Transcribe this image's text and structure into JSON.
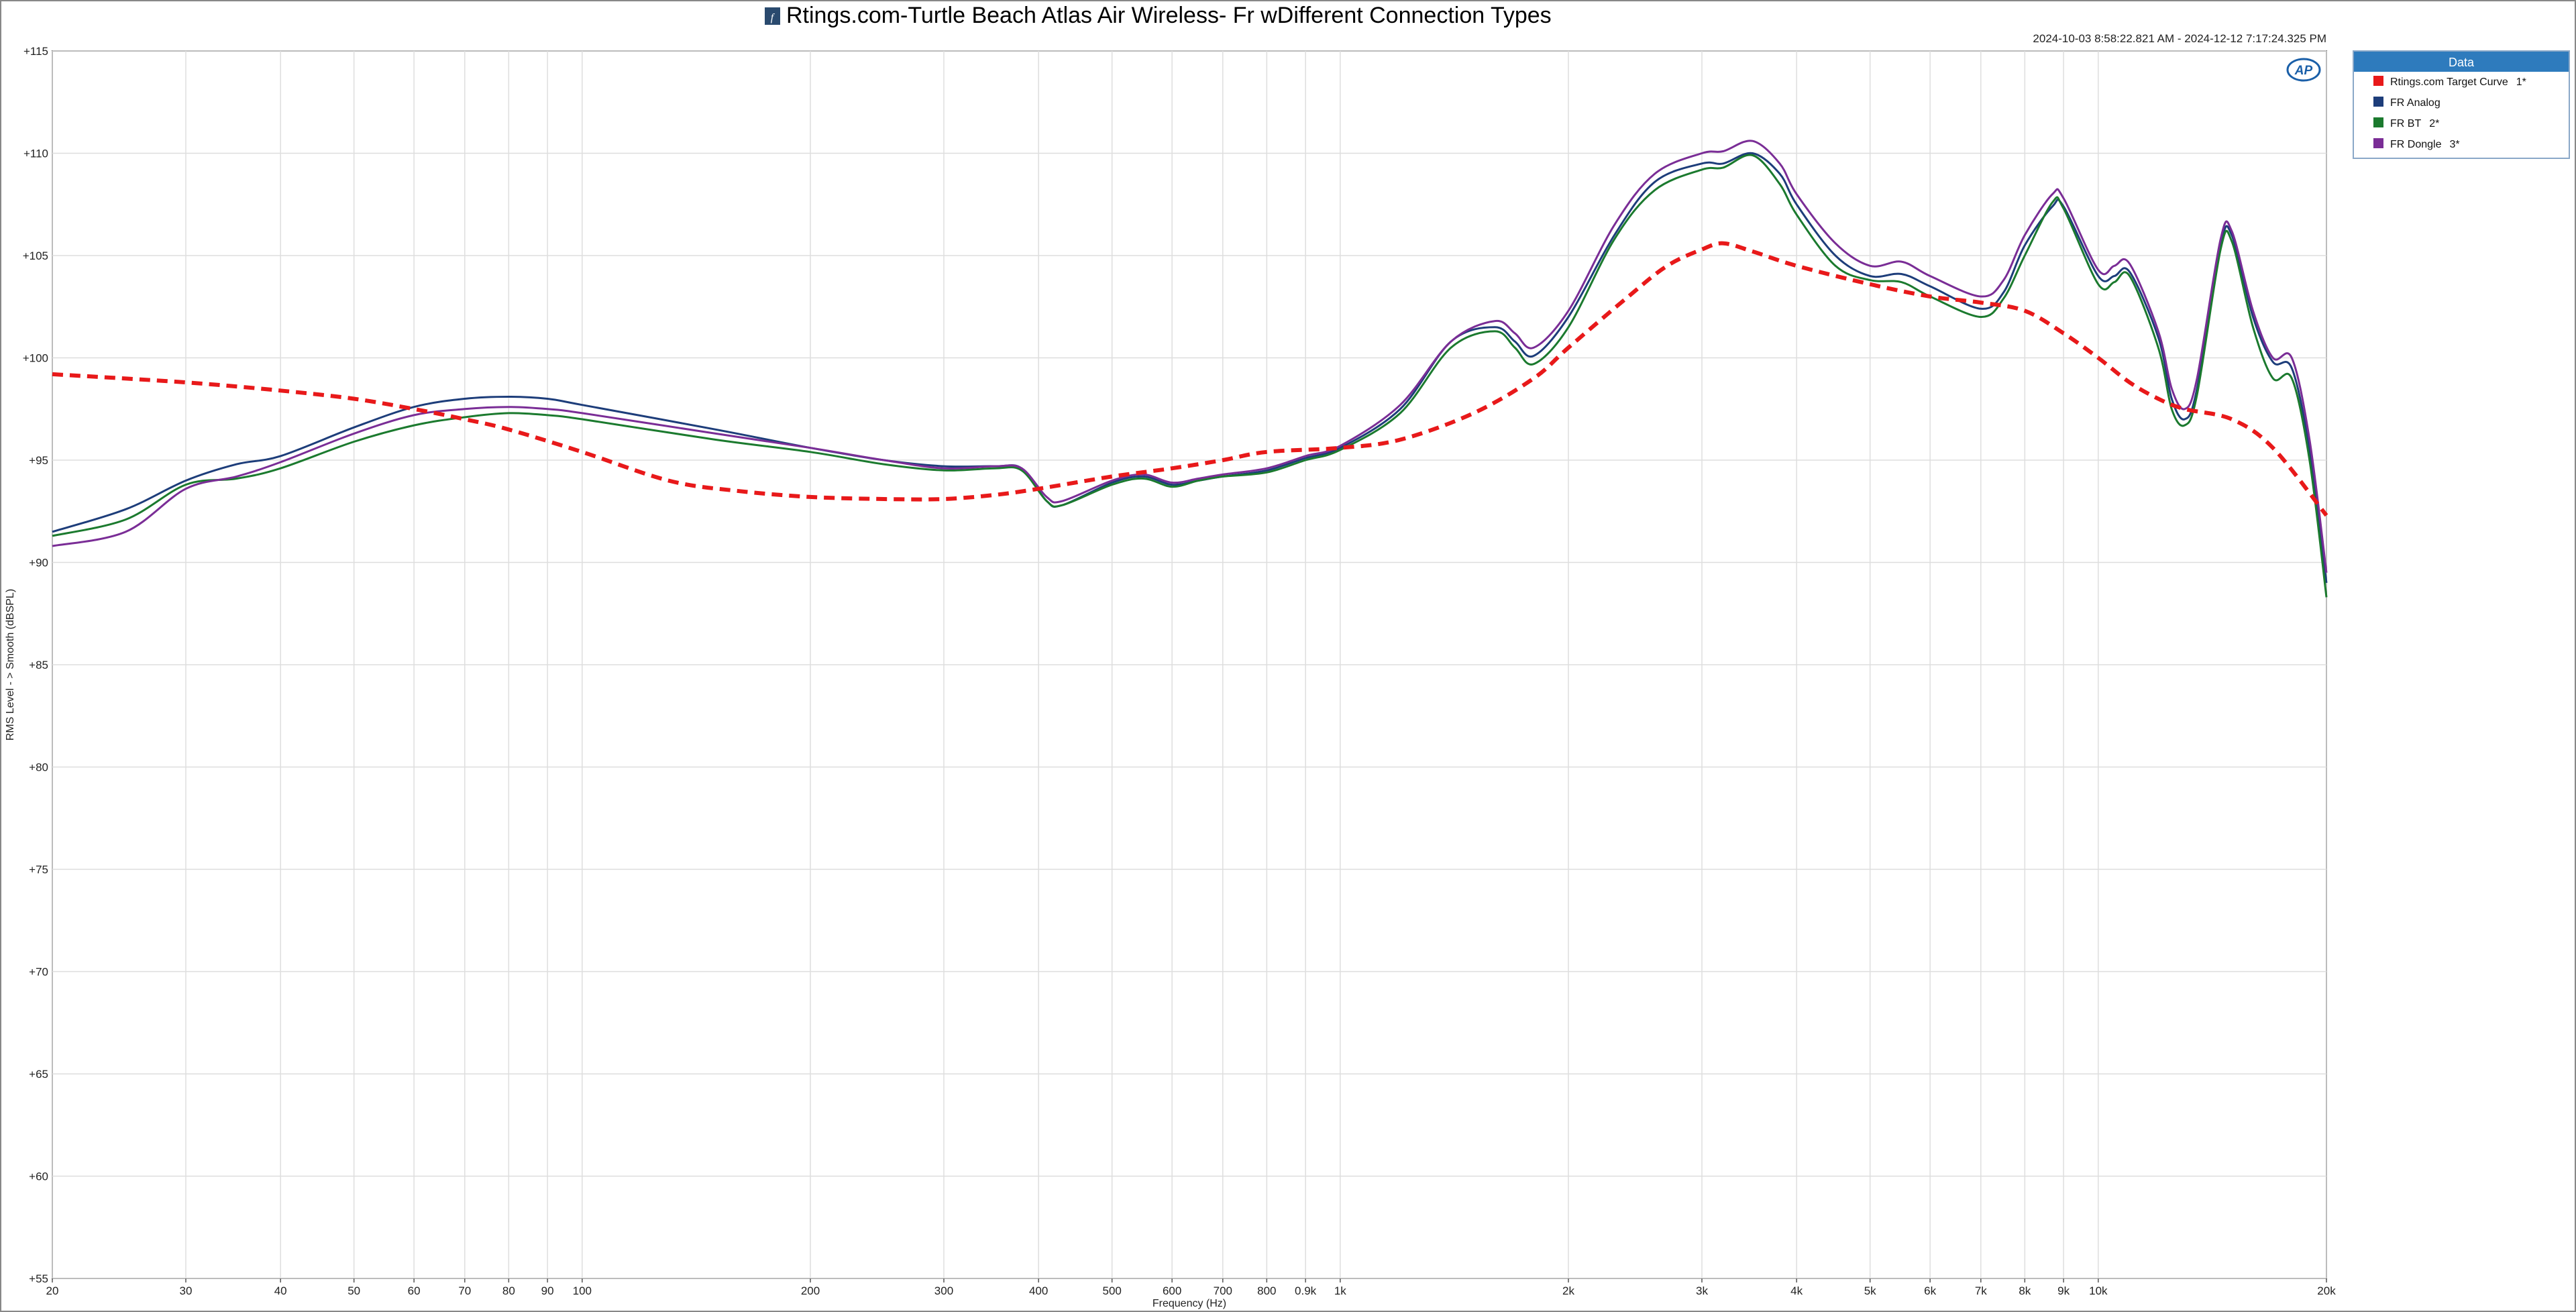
{
  "header": {
    "title": "Rtings.com-Turtle Beach Atlas Air Wireless- Fr wDifferent Connection Types",
    "title_icon": "fx-icon",
    "timestamp": "2024-10-03 8:58:22.821 AM - 2024-12-12 7:17:24.325 PM",
    "logo": "AP"
  },
  "legend": {
    "heading": "Data",
    "items": [
      {
        "label": "Rtings.com Target Curve",
        "suffix": "1*",
        "color": "#e8191a"
      },
      {
        "label": "FR Analog",
        "suffix": "",
        "color": "#1d3d7a"
      },
      {
        "label": "FR BT",
        "suffix": "2*",
        "color": "#1b7a2e"
      },
      {
        "label": "FR Dongle",
        "suffix": "3*",
        "color": "#7a2d96"
      }
    ]
  },
  "chart_data": {
    "type": "line",
    "xlabel": "Frequency (Hz)",
    "ylabel": "RMS Level - > Smooth (dBSPL)",
    "xscale": "log",
    "xlim": [
      20,
      20000
    ],
    "ylim": [
      55,
      115
    ],
    "grid": true,
    "legend_placement": "right",
    "x_ticks": [
      {
        "v": 20,
        "l": "20"
      },
      {
        "v": 30,
        "l": "30"
      },
      {
        "v": 40,
        "l": "40"
      },
      {
        "v": 50,
        "l": "50"
      },
      {
        "v": 60,
        "l": "60"
      },
      {
        "v": 70,
        "l": "70"
      },
      {
        "v": 80,
        "l": "80"
      },
      {
        "v": 90,
        "l": "90"
      },
      {
        "v": 100,
        "l": "100"
      },
      {
        "v": 200,
        "l": "200"
      },
      {
        "v": 300,
        "l": "300"
      },
      {
        "v": 400,
        "l": "400"
      },
      {
        "v": 500,
        "l": "500"
      },
      {
        "v": 600,
        "l": "600"
      },
      {
        "v": 700,
        "l": "700"
      },
      {
        "v": 800,
        "l": "800"
      },
      {
        "v": 900,
        "l": "0.9k"
      },
      {
        "v": 1000,
        "l": "1k"
      },
      {
        "v": 2000,
        "l": "2k"
      },
      {
        "v": 3000,
        "l": "3k"
      },
      {
        "v": 4000,
        "l": "4k"
      },
      {
        "v": 5000,
        "l": "5k"
      },
      {
        "v": 6000,
        "l": "6k"
      },
      {
        "v": 7000,
        "l": "7k"
      },
      {
        "v": 8000,
        "l": "8k"
      },
      {
        "v": 9000,
        "l": "9k"
      },
      {
        "v": 10000,
        "l": "10k"
      },
      {
        "v": 20000,
        "l": "20k"
      }
    ],
    "y_ticks": [
      {
        "v": 115,
        "l": "+115"
      },
      {
        "v": 110,
        "l": "+110"
      },
      {
        "v": 105,
        "l": "+105"
      },
      {
        "v": 100,
        "l": "+100"
      },
      {
        "v": 95,
        "l": "+95"
      },
      {
        "v": 90,
        "l": "+90"
      },
      {
        "v": 85,
        "l": "+85"
      },
      {
        "v": 80,
        "l": "+80"
      },
      {
        "v": 75,
        "l": "+75"
      },
      {
        "v": 70,
        "l": "+70"
      },
      {
        "v": 65,
        "l": "+65"
      },
      {
        "v": 60,
        "l": "+60"
      },
      {
        "v": 55,
        "l": "+55"
      }
    ],
    "series": [
      {
        "name": "Rtings.com Target Curve",
        "color": "#e8191a",
        "dashed": true,
        "points": [
          [
            20,
            99.2
          ],
          [
            30,
            98.8
          ],
          [
            40,
            98.4
          ],
          [
            50,
            98.0
          ],
          [
            60,
            97.5
          ],
          [
            70,
            97.0
          ],
          [
            80,
            96.5
          ],
          [
            100,
            95.4
          ],
          [
            130,
            94.0
          ],
          [
            160,
            93.5
          ],
          [
            200,
            93.2
          ],
          [
            250,
            93.1
          ],
          [
            300,
            93.1
          ],
          [
            350,
            93.3
          ],
          [
            400,
            93.6
          ],
          [
            500,
            94.2
          ],
          [
            600,
            94.6
          ],
          [
            700,
            95.0
          ],
          [
            800,
            95.4
          ],
          [
            1000,
            95.6
          ],
          [
            1200,
            96.0
          ],
          [
            1500,
            97.3
          ],
          [
            1800,
            99.0
          ],
          [
            2000,
            100.5
          ],
          [
            2400,
            103.0
          ],
          [
            2700,
            104.5
          ],
          [
            3000,
            105.3
          ],
          [
            3200,
            105.6
          ],
          [
            3500,
            105.2
          ],
          [
            4000,
            104.5
          ],
          [
            5000,
            103.6
          ],
          [
            6000,
            103.0
          ],
          [
            7000,
            102.7
          ],
          [
            8000,
            102.3
          ],
          [
            9000,
            101.2
          ],
          [
            10000,
            100.0
          ],
          [
            11000,
            98.8
          ],
          [
            12000,
            98.0
          ],
          [
            13000,
            97.5
          ],
          [
            15000,
            97.0
          ],
          [
            17000,
            95.6
          ],
          [
            20000,
            92.3
          ]
        ]
      },
      {
        "name": "FR Analog",
        "color": "#1d3d7a",
        "dashed": false,
        "points": [
          [
            20,
            91.5
          ],
          [
            25,
            92.6
          ],
          [
            30,
            94.0
          ],
          [
            35,
            94.8
          ],
          [
            40,
            95.2
          ],
          [
            50,
            96.6
          ],
          [
            60,
            97.6
          ],
          [
            70,
            98.0
          ],
          [
            80,
            98.1
          ],
          [
            90,
            98.0
          ],
          [
            100,
            97.7
          ],
          [
            150,
            96.5
          ],
          [
            200,
            95.6
          ],
          [
            250,
            95.0
          ],
          [
            300,
            94.7
          ],
          [
            350,
            94.7
          ],
          [
            380,
            94.6
          ],
          [
            410,
            93.0
          ],
          [
            430,
            92.8
          ],
          [
            500,
            93.9
          ],
          [
            550,
            94.2
          ],
          [
            600,
            93.8
          ],
          [
            650,
            94.0
          ],
          [
            700,
            94.2
          ],
          [
            800,
            94.5
          ],
          [
            900,
            95.1
          ],
          [
            1000,
            95.6
          ],
          [
            1200,
            97.5
          ],
          [
            1400,
            100.8
          ],
          [
            1600,
            101.5
          ],
          [
            1700,
            100.8
          ],
          [
            1800,
            100.1
          ],
          [
            2000,
            102.0
          ],
          [
            2300,
            106.0
          ],
          [
            2600,
            108.6
          ],
          [
            3000,
            109.5
          ],
          [
            3200,
            109.5
          ],
          [
            3500,
            110.0
          ],
          [
            3800,
            109.0
          ],
          [
            4000,
            107.5
          ],
          [
            4500,
            105.0
          ],
          [
            5000,
            104.0
          ],
          [
            5500,
            104.1
          ],
          [
            6000,
            103.5
          ],
          [
            7000,
            102.4
          ],
          [
            7500,
            103.2
          ],
          [
            8000,
            105.5
          ],
          [
            8700,
            107.4
          ],
          [
            9000,
            107.4
          ],
          [
            10000,
            104.0
          ],
          [
            10500,
            104.0
          ],
          [
            11000,
            104.2
          ],
          [
            12000,
            101.0
          ],
          [
            12500,
            98.0
          ],
          [
            13000,
            97.0
          ],
          [
            13500,
            98.5
          ],
          [
            14500,
            105.5
          ],
          [
            15000,
            106.0
          ],
          [
            16000,
            102.0
          ],
          [
            17000,
            99.8
          ],
          [
            18000,
            99.5
          ],
          [
            19000,
            95.5
          ],
          [
            20000,
            89.0
          ]
        ]
      },
      {
        "name": "FR BT",
        "color": "#1b7a2e",
        "dashed": false,
        "points": [
          [
            20,
            91.3
          ],
          [
            25,
            92.1
          ],
          [
            30,
            93.8
          ],
          [
            35,
            94.1
          ],
          [
            40,
            94.6
          ],
          [
            50,
            95.9
          ],
          [
            60,
            96.7
          ],
          [
            70,
            97.1
          ],
          [
            80,
            97.3
          ],
          [
            90,
            97.2
          ],
          [
            100,
            97.0
          ],
          [
            150,
            96.0
          ],
          [
            200,
            95.4
          ],
          [
            250,
            94.8
          ],
          [
            300,
            94.5
          ],
          [
            350,
            94.6
          ],
          [
            380,
            94.5
          ],
          [
            410,
            93.0
          ],
          [
            430,
            92.8
          ],
          [
            500,
            93.8
          ],
          [
            550,
            94.1
          ],
          [
            600,
            93.7
          ],
          [
            650,
            94.0
          ],
          [
            700,
            94.2
          ],
          [
            800,
            94.4
          ],
          [
            900,
            95.0
          ],
          [
            1000,
            95.5
          ],
          [
            1200,
            97.3
          ],
          [
            1400,
            100.5
          ],
          [
            1600,
            101.3
          ],
          [
            1700,
            100.5
          ],
          [
            1800,
            99.7
          ],
          [
            2000,
            101.5
          ],
          [
            2300,
            105.8
          ],
          [
            2600,
            108.2
          ],
          [
            3000,
            109.2
          ],
          [
            3200,
            109.3
          ],
          [
            3500,
            109.9
          ],
          [
            3800,
            108.5
          ],
          [
            4000,
            107.0
          ],
          [
            4500,
            104.5
          ],
          [
            5000,
            103.8
          ],
          [
            5500,
            103.7
          ],
          [
            6000,
            103.0
          ],
          [
            7000,
            102.0
          ],
          [
            7500,
            102.9
          ],
          [
            8000,
            105.0
          ],
          [
            8700,
            107.6
          ],
          [
            9000,
            107.3
          ],
          [
            10000,
            103.6
          ],
          [
            10500,
            103.7
          ],
          [
            11000,
            104.0
          ],
          [
            12000,
            100.5
          ],
          [
            12500,
            97.5
          ],
          [
            13000,
            96.7
          ],
          [
            13500,
            98.2
          ],
          [
            14500,
            105.3
          ],
          [
            15000,
            105.7
          ],
          [
            16000,
            101.5
          ],
          [
            17000,
            99.0
          ],
          [
            18000,
            99.0
          ],
          [
            19000,
            95.0
          ],
          [
            20000,
            88.3
          ]
        ]
      },
      {
        "name": "FR Dongle",
        "color": "#7a2d96",
        "dashed": false,
        "points": [
          [
            20,
            90.8
          ],
          [
            25,
            91.5
          ],
          [
            30,
            93.6
          ],
          [
            35,
            94.2
          ],
          [
            40,
            94.9
          ],
          [
            50,
            96.3
          ],
          [
            60,
            97.2
          ],
          [
            70,
            97.5
          ],
          [
            80,
            97.6
          ],
          [
            90,
            97.5
          ],
          [
            100,
            97.3
          ],
          [
            150,
            96.3
          ],
          [
            200,
            95.6
          ],
          [
            250,
            95.0
          ],
          [
            300,
            94.6
          ],
          [
            350,
            94.7
          ],
          [
            380,
            94.6
          ],
          [
            410,
            93.2
          ],
          [
            430,
            93.0
          ],
          [
            500,
            94.0
          ],
          [
            550,
            94.3
          ],
          [
            600,
            93.9
          ],
          [
            650,
            94.1
          ],
          [
            700,
            94.3
          ],
          [
            800,
            94.6
          ],
          [
            900,
            95.2
          ],
          [
            1000,
            95.7
          ],
          [
            1200,
            97.7
          ],
          [
            1400,
            100.8
          ],
          [
            1600,
            101.8
          ],
          [
            1700,
            101.2
          ],
          [
            1800,
            100.5
          ],
          [
            2000,
            102.3
          ],
          [
            2300,
            106.5
          ],
          [
            2600,
            109.0
          ],
          [
            3000,
            110.0
          ],
          [
            3200,
            110.1
          ],
          [
            3500,
            110.6
          ],
          [
            3800,
            109.5
          ],
          [
            4000,
            108.0
          ],
          [
            4500,
            105.6
          ],
          [
            5000,
            104.5
          ],
          [
            5500,
            104.7
          ],
          [
            6000,
            104.0
          ],
          [
            7000,
            103.0
          ],
          [
            7500,
            103.8
          ],
          [
            8000,
            106.0
          ],
          [
            8700,
            108.0
          ],
          [
            9000,
            107.8
          ],
          [
            10000,
            104.3
          ],
          [
            10500,
            104.5
          ],
          [
            11000,
            104.6
          ],
          [
            12000,
            101.3
          ],
          [
            12500,
            98.5
          ],
          [
            13000,
            97.5
          ],
          [
            13500,
            99.0
          ],
          [
            14500,
            105.8
          ],
          [
            15000,
            106.2
          ],
          [
            16000,
            102.3
          ],
          [
            17000,
            100.0
          ],
          [
            18000,
            100.0
          ],
          [
            19000,
            96.0
          ],
          [
            20000,
            89.5
          ]
        ]
      }
    ]
  }
}
